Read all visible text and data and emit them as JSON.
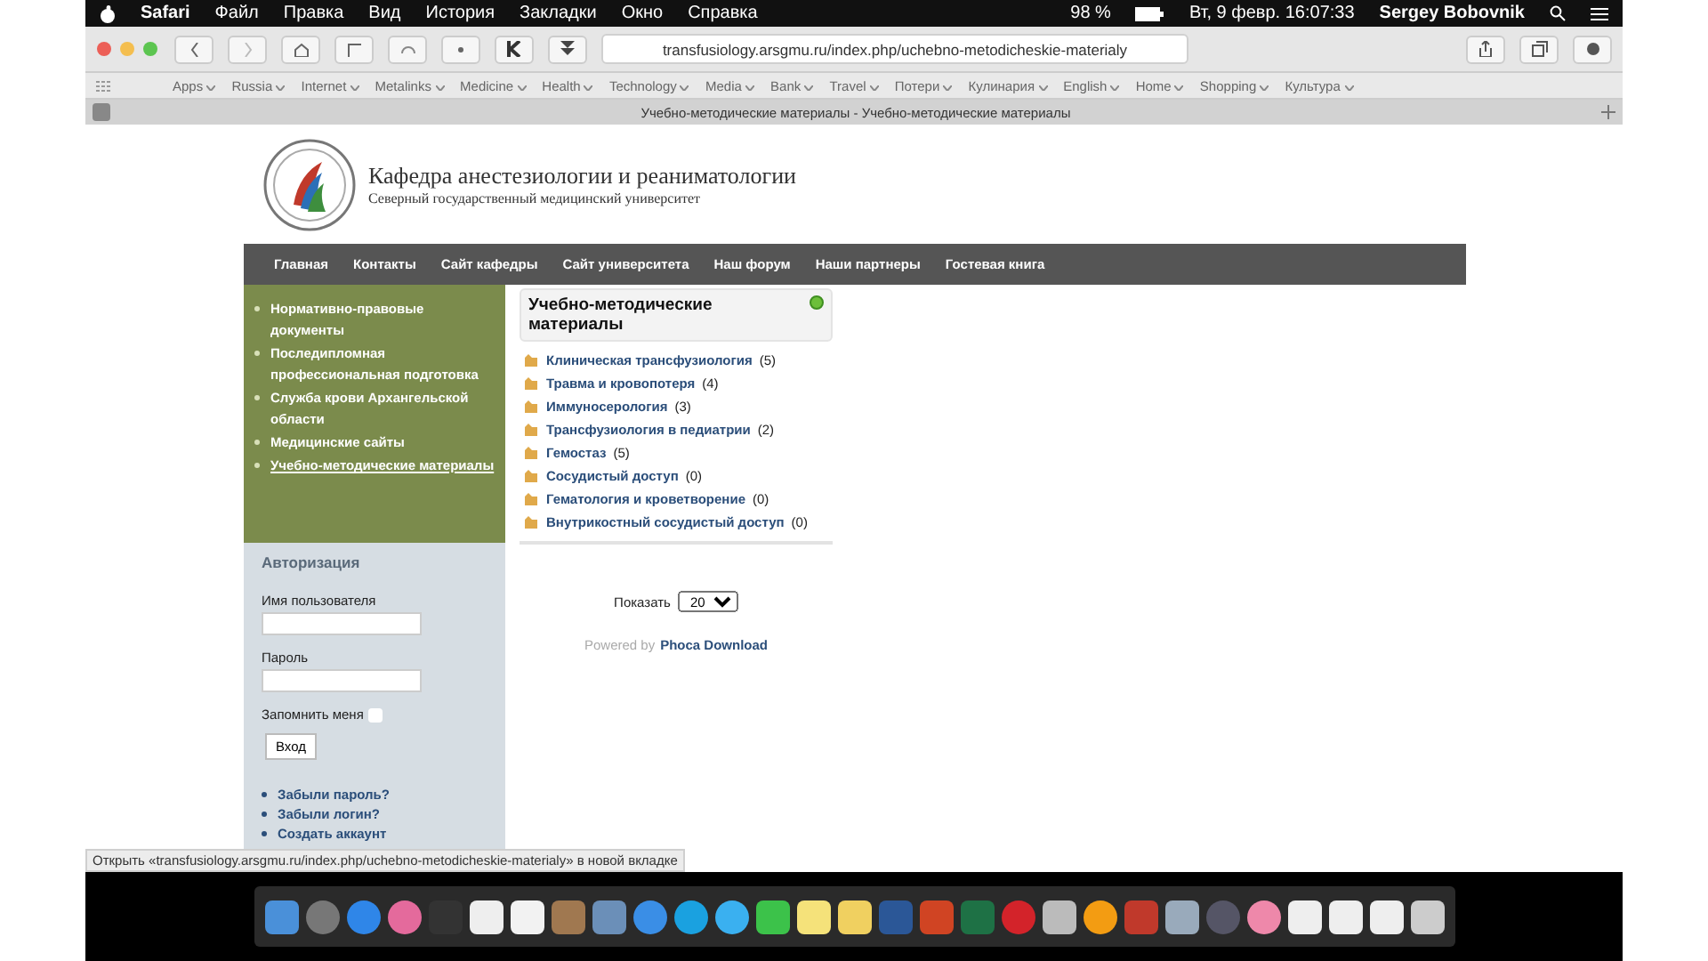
{
  "menu_bar": {
    "menus": [
      "Safari",
      "Файл",
      "Правка",
      "Вид",
      "История",
      "Закладки",
      "Окно",
      "Справка"
    ],
    "battery": "98 %",
    "clock": "Вт, 9 февр. 16:07:33",
    "user": "Sergey Bobovnik"
  },
  "toolbar": {
    "address": "transfusiology.arsgmu.ru/index.php/uchebno-metodicheskie-materialy"
  },
  "bookmarks": [
    "Apps",
    "Russia",
    "Internet",
    "Metalinks",
    "Medicine",
    "Health",
    "Technology",
    "Media",
    "Bank",
    "Travel",
    "Потери",
    "Кулинария",
    "English",
    "Home",
    "Shopping",
    "Культура"
  ],
  "tab": {
    "title": "Учебно-методические материалы - Учебно-методические материалы"
  },
  "site": {
    "title": "Кафедра анестезиологии и реаниматологии",
    "subtitle": "Северный государственный медицинский университет",
    "nav": [
      "Главная",
      "Контакты",
      "Сайт кафедры",
      "Сайт университета",
      "Наш форум",
      "Наши партнеры",
      "Гостевая книга"
    ],
    "sidebar_menu": [
      {
        "label": "Нормативно-правовые документы",
        "selected": false
      },
      {
        "label": "Последипломная профессиональная подготовка",
        "selected": false
      },
      {
        "label": "Служба крови Архангельской области",
        "selected": false
      },
      {
        "label": "Медицинские сайты",
        "selected": false
      },
      {
        "label": "Учебно-методические материалы",
        "selected": true
      }
    ],
    "login": {
      "heading": "Авторизация",
      "username_label": "Имя пользователя",
      "password_label": "Пароль",
      "remember_label": "Запомнить меня",
      "remember": false,
      "button": "Вход",
      "links": [
        "Забыли пароль?",
        "Забыли логин?",
        "Создать аккаунт"
      ]
    },
    "category_panel": {
      "title": "Учебно-методические материалы",
      "items": [
        {
          "name": "Клиническая трансфузиология",
          "count": "(5)"
        },
        {
          "name": "Травма и кровопотеря",
          "count": "(4)"
        },
        {
          "name": "Иммуносерология",
          "count": "(3)"
        },
        {
          "name": "Трансфузиология в педиатрии",
          "count": "(2)"
        },
        {
          "name": "Гемостаз",
          "count": "(5)"
        },
        {
          "name": "Сосудистый доступ",
          "count": "(0)"
        },
        {
          "name": "Гематология и кроветворение",
          "count": "(0)"
        },
        {
          "name": "Внутрикостный сосудистый доступ",
          "count": "(0)"
        }
      ]
    },
    "show_label": "Показать",
    "show_value": "20",
    "powered_prefix": "Powered by",
    "powered_link": "Phoca Download"
  },
  "status_bar": "Открыть «transfusiology.arsgmu.ru/index.php/uchebno-metodicheskie-materialy» в новой вкладке"
}
